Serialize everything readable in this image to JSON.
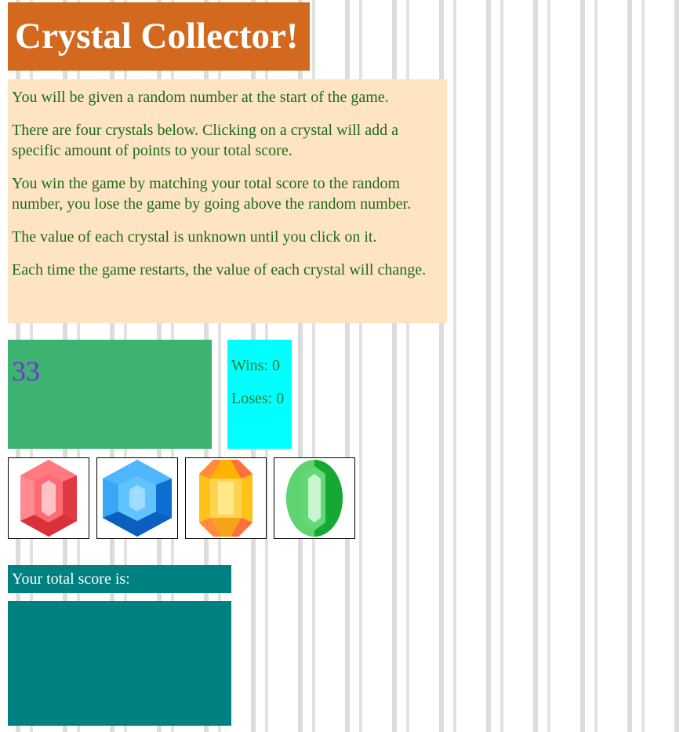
{
  "title": "Crystal Collector!",
  "instructions": [
    "You will be given a random number at the start of the game.",
    "There are four crystals below. Clicking on a crystal will add a specific amount of points to your total score.",
    "You win the game by matching your total score to the random number, you lose the game by going above the random number.",
    "The value of each crystal is unknown until you click on it.",
    "Each time the game restarts, the value of each crystal will change."
  ],
  "target_number": "33",
  "stats": {
    "wins": "Wins: 0",
    "losses": "Loses: 0"
  },
  "crystals": [
    {
      "name": "red-crystal-icon",
      "color": "#f2545b"
    },
    {
      "name": "blue-crystal-icon",
      "color": "#1e90ff"
    },
    {
      "name": "yellow-crystal-icon",
      "color": "#ffc933"
    },
    {
      "name": "green-crystal-icon",
      "color": "#2ebd4e"
    }
  ],
  "score": {
    "label": "Your total score is:",
    "value": ""
  },
  "colors": {
    "title_bg": "#d2691e",
    "instructions_bg": "#ffe4c4",
    "instructions_text": "#1d6b1d",
    "target_bg": "#3cb371",
    "target_text": "#7b2fd6",
    "stats_bg": "#00ffff",
    "score_bg": "#008080"
  }
}
